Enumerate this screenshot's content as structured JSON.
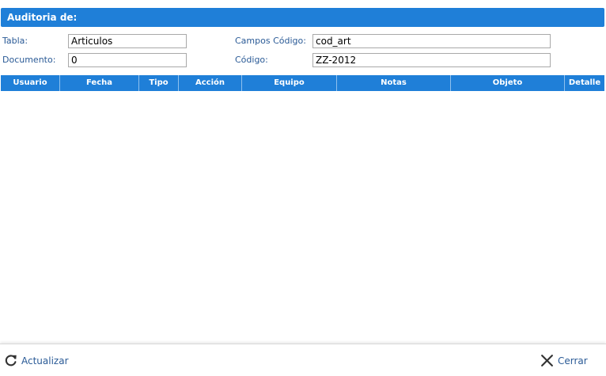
{
  "dialog": {
    "title": "Auditoria de:"
  },
  "form": {
    "tabla_label": "Tabla:",
    "tabla_value": "Articulos",
    "documento_label": "Documento:",
    "documento_value": "0",
    "campos_codigo_label": "Campos Código:",
    "campos_codigo_value": "cod_art",
    "codigo_label": "Código:",
    "codigo_value": "ZZ-2012"
  },
  "grid": {
    "columns": [
      "Usuario",
      "Fecha",
      "Tipo",
      "Acción",
      "Equipo",
      "Notas",
      "Objeto",
      "Detalle"
    ],
    "rows": []
  },
  "footer": {
    "refresh_label": "Actualizar",
    "refresh_icon": "refresh-icon",
    "close_label": "Cerrar",
    "close_icon": "close-icon"
  },
  "colors": {
    "accent": "#1f7fd8",
    "label_text": "#2a5a96"
  }
}
